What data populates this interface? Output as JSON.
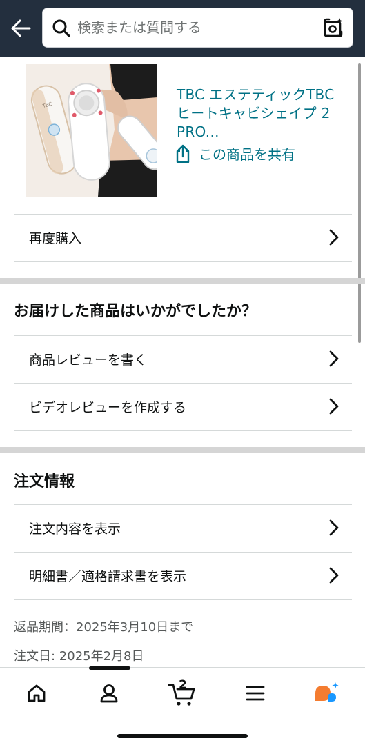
{
  "header": {
    "search_placeholder": "検索または質問する"
  },
  "product": {
    "title": "TBC エステティックTBC ヒートキャビシェイプ 2 PRO...",
    "share_label": "この商品を共有",
    "image_brand_text": "TBC"
  },
  "rows": {
    "buy_again": "再度購入"
  },
  "feedback": {
    "heading": "お届けした商品はいかがでしたか？",
    "write_review": "商品レビューを書く",
    "video_review": "ビデオレビューを作成する"
  },
  "order_info": {
    "heading": "注文情報",
    "view_order": "注文内容を表示",
    "view_invoice": "明細書／適格請求書を表示",
    "return_period": "返品期間：2025年3月10日まで",
    "order_date": "注文日: 2025年2月8日"
  },
  "bottom_nav": {
    "items": [
      {
        "icon": "home-icon"
      },
      {
        "icon": "account-icon"
      },
      {
        "icon": "cart-icon",
        "count": "2"
      },
      {
        "icon": "menu-icon"
      },
      {
        "icon": "rufus-icon"
      }
    ]
  },
  "colors": {
    "header_bg": "#232f3e",
    "link": "#007185",
    "rufus_orange": "#f47c30",
    "rufus_blue": "#1a98ff"
  }
}
